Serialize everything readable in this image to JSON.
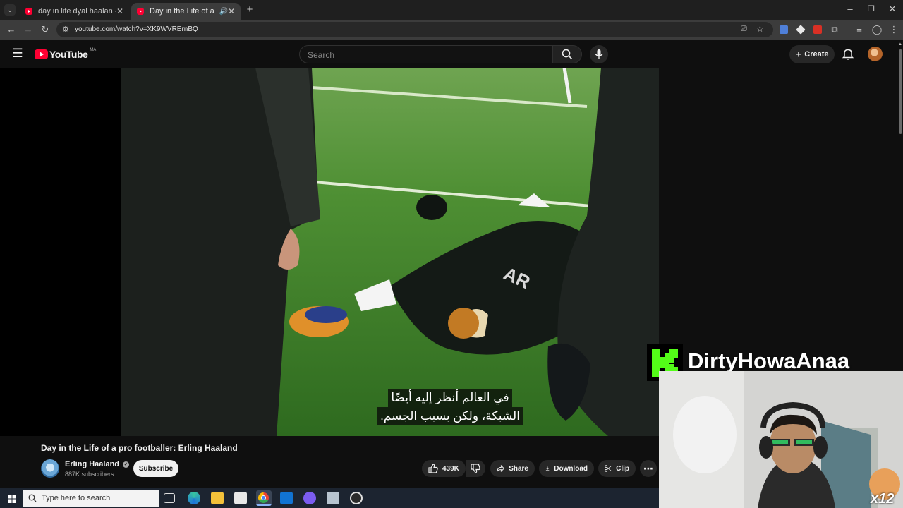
{
  "browser": {
    "tabs": [
      {
        "title": "day in life dyal haalan - YouTube",
        "active": false
      },
      {
        "title": "Day in the Life of a pro footballer",
        "active": true
      }
    ],
    "url": "youtube.com/watch?v=XK9WVRErnBQ"
  },
  "youtube": {
    "logo_text": "YouTube",
    "region": "MA",
    "search_placeholder": "Search",
    "create_label": "Create"
  },
  "video": {
    "subtitle_line1": "في العالم أنظر إليه أيضًا",
    "subtitle_line2": "الشبكة، ولكن بسبب الجسم."
  },
  "overlay": {
    "streamer_name": "DirtyHowaAnaa",
    "badge": "x12"
  },
  "meta": {
    "title": "Day in the Life of a pro footballer: Erling Haaland",
    "channel": "Erling Haaland",
    "subscribers": "887K subscribers",
    "subscribe_label": "Subscribe",
    "likes": "439K",
    "share_label": "Share",
    "download_label": "Download",
    "clip_label": "Clip"
  },
  "taskbar": {
    "search_placeholder": "Type here to search"
  },
  "colors": {
    "youtube_red": "#ff0033",
    "kick_green": "#53fc18",
    "background": "#0f0f0f"
  }
}
